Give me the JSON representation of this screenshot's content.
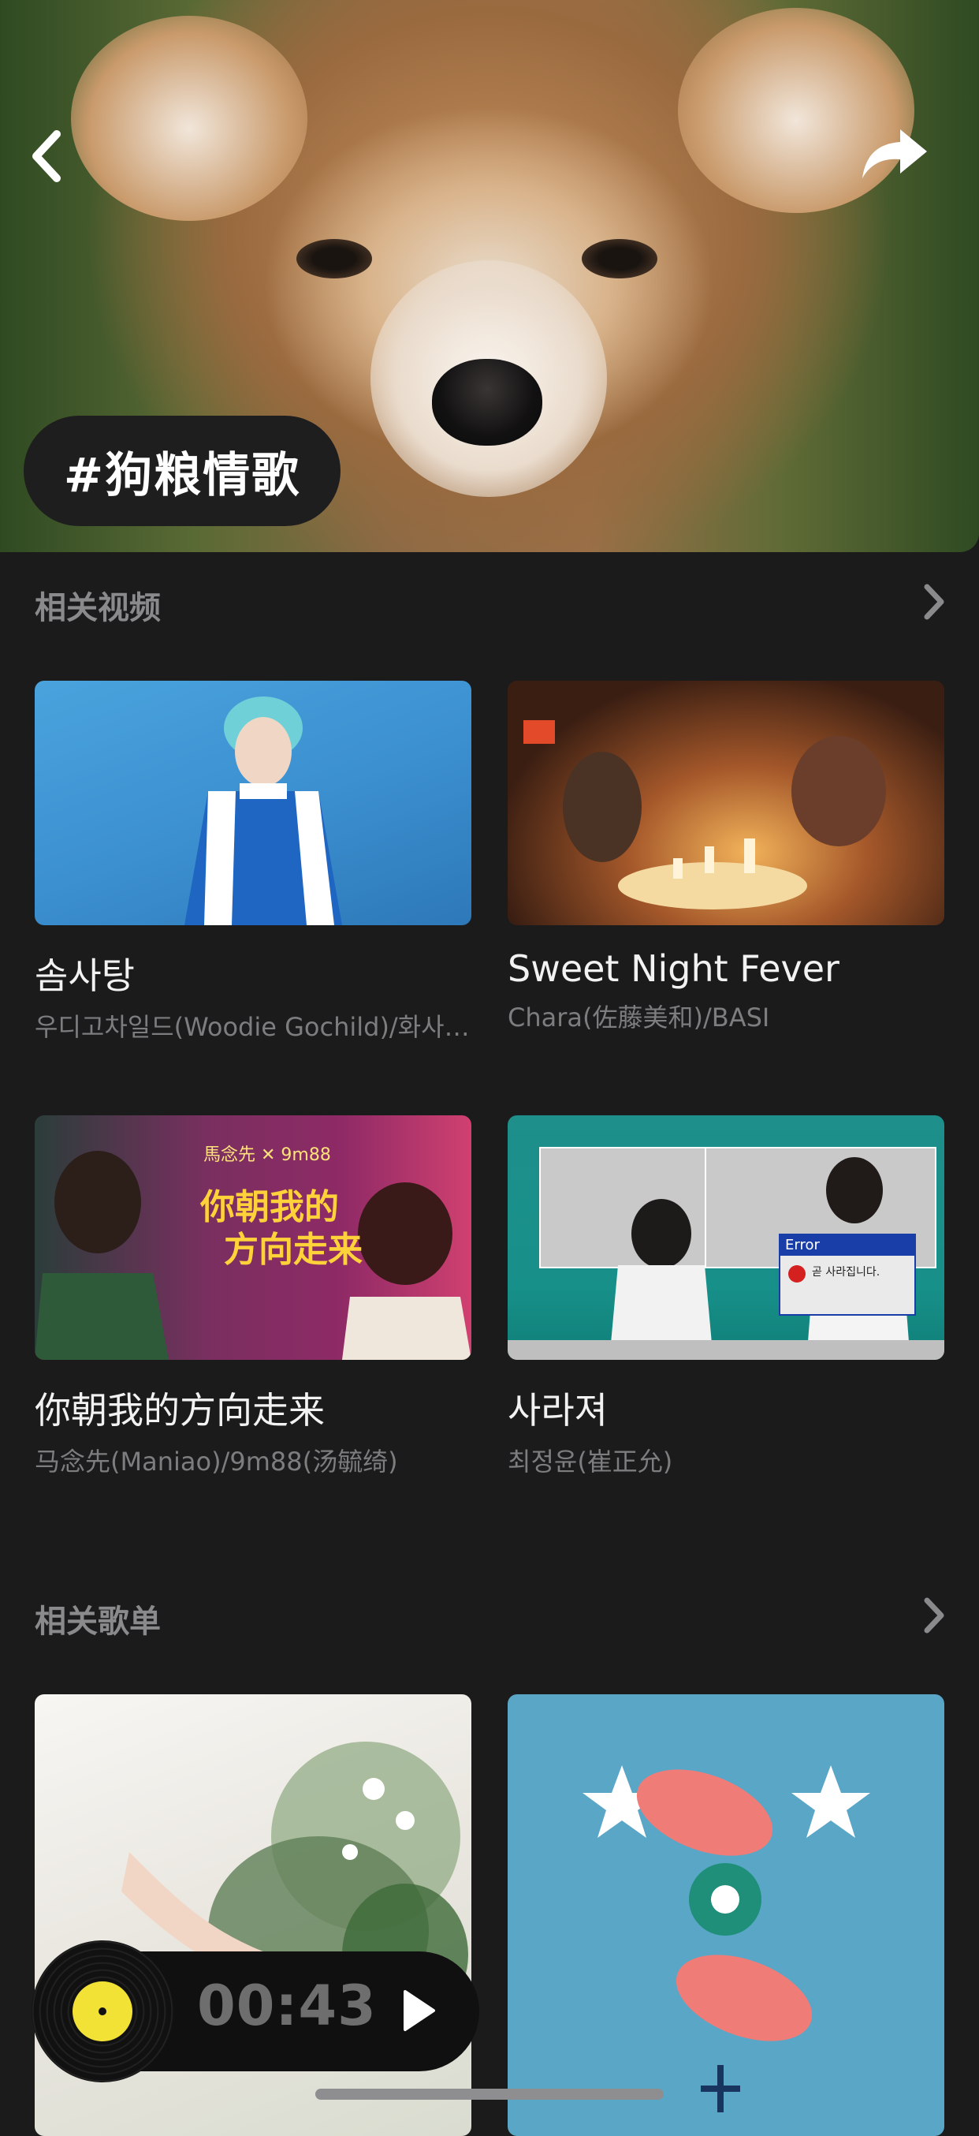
{
  "header": {
    "tag": "#狗粮情歌"
  },
  "related_videos": {
    "title": "相关视频",
    "items": [
      {
        "title": "솜사탕",
        "artist": "우디고차일드(Woodie Gochild)/화사(HWA SA)"
      },
      {
        "title": "Sweet Night Fever",
        "artist": "Chara(佐藤美和)/BASI"
      },
      {
        "title": "你朝我的方向走来",
        "artist": "马念先(Maniao)/9m88(汤毓绮)",
        "thumb_text_1": "你朝我的",
        "thumb_text_2": "方向走来",
        "thumb_small": "馬念先 ✕ 9m88"
      },
      {
        "title": "사라져",
        "artist": "최정윤(崔正允)",
        "thumb_error_title": "Error",
        "thumb_error_msg": "곧 사라집니다."
      }
    ]
  },
  "related_playlists": {
    "title": "相关歌单"
  },
  "player": {
    "time": "00:43"
  },
  "colors": {
    "background": "#1b1b1c",
    "disc_label": "#f2e236"
  },
  "icons": [
    "back-chevron-icon",
    "share-icon",
    "chevron-right-icon",
    "vinyl-disc-icon",
    "play-icon"
  ]
}
